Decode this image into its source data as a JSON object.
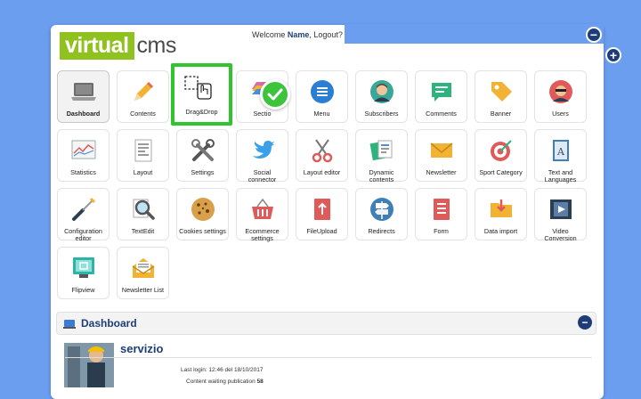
{
  "brand": {
    "logo_virtual": "virtual",
    "logo_cms": "cms"
  },
  "header": {
    "welcome_prefix": "Welcome ",
    "user_name": "Name",
    "welcome_suffix": ", Logout?"
  },
  "window_buttons": {
    "collapse": "−",
    "expand": "+"
  },
  "modules": [
    {
      "label": "Dashboard",
      "icon": "laptop-icon",
      "active": true
    },
    {
      "label": "Contents",
      "icon": "pencil-icon"
    },
    {
      "label": "Drag&Drop",
      "icon": "drag-drop-icon",
      "highlighted": true
    },
    {
      "label": "Sectio",
      "icon": "sections-icon"
    },
    {
      "label": "Menu",
      "icon": "menu-icon"
    },
    {
      "label": "Subscribers",
      "icon": "subscriber-avatar-icon"
    },
    {
      "label": "Comments",
      "icon": "comment-bubble-icon"
    },
    {
      "label": "Banner",
      "icon": "tag-icon"
    },
    {
      "label": "Users",
      "icon": "user-avatar-icon"
    },
    {
      "label": "Statistics",
      "icon": "line-chart-icon"
    },
    {
      "label": "Layout",
      "icon": "document-icon"
    },
    {
      "label": "Settings",
      "icon": "tools-icon"
    },
    {
      "label": "Social connector",
      "icon": "twitter-bird-icon"
    },
    {
      "label": "Layout editor",
      "icon": "scissors-icon"
    },
    {
      "label": "Dynamic contents",
      "icon": "dynamic-docs-icon"
    },
    {
      "label": "Newsletter",
      "icon": "envelope-icon"
    },
    {
      "label": "Sport Category",
      "icon": "target-icon"
    },
    {
      "label": "Text and Languages",
      "icon": "dictionary-icon"
    },
    {
      "label": "Configuration editor",
      "icon": "screwdriver-icon"
    },
    {
      "label": "TextEdit",
      "icon": "magnifier-icon"
    },
    {
      "label": "Cookies settings",
      "icon": "cookie-icon"
    },
    {
      "label": "Ecommerce settings",
      "icon": "basket-icon"
    },
    {
      "label": "FileUpload",
      "icon": "upload-icon"
    },
    {
      "label": "Redirects",
      "icon": "signpost-icon"
    },
    {
      "label": "Form",
      "icon": "form-icon"
    },
    {
      "label": "Data import",
      "icon": "folder-import-icon"
    },
    {
      "label": "Video Conversion",
      "icon": "film-icon"
    },
    {
      "label": "Flipview",
      "icon": "flipview-icon"
    },
    {
      "label": "Newsletter List",
      "icon": "open-envelope-icon"
    }
  ],
  "dashboard": {
    "title": "Dashboard",
    "profile_name": "servizio",
    "last_login": "Last login: 12:46 del 18/10/2017",
    "content_waiting_label": "Content waiting publication",
    "content_waiting_count": "58"
  },
  "colors": {
    "accent": "#1e3d78",
    "brand_green": "#8fc21e",
    "background": "#6c9ef0",
    "highlight": "#2ec52e"
  }
}
